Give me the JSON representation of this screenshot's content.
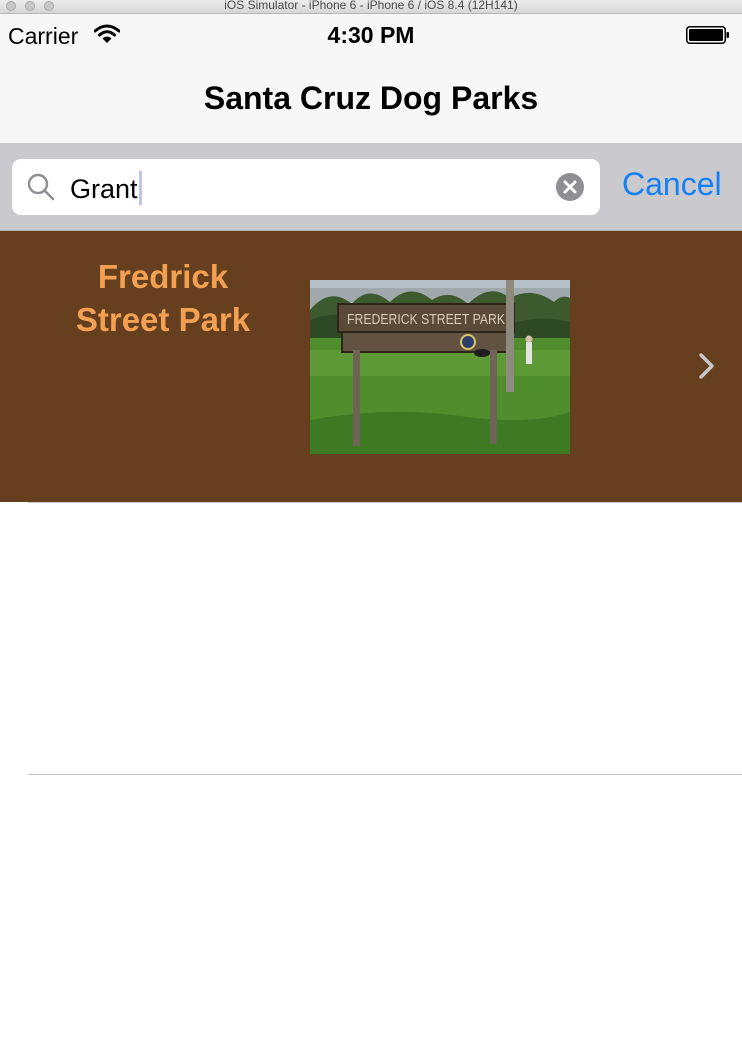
{
  "simulator": {
    "window_title": "iOS Simulator - iPhone 6 - iPhone 6 / iOS 8.4 (12H141)"
  },
  "status_bar": {
    "carrier": "Carrier",
    "time": "4:30 PM",
    "wifi_icon": "wifi-icon",
    "battery_icon": "battery-icon"
  },
  "nav": {
    "title": "Santa Cruz Dog Parks"
  },
  "search": {
    "value": "Grant",
    "cancel_label": "Cancel",
    "search_icon": "magnifier-icon",
    "clear_icon": "clear-x-icon"
  },
  "results": [
    {
      "name": "Fredrick Street Park",
      "photo_sign_text": "FREDERICK STREET PARK",
      "accessory_icon": "chevron-right-icon"
    }
  ],
  "colors": {
    "row_background": "#653f1e",
    "park_name_text": "#f4a052",
    "tint": "#1480f8",
    "search_bar_background": "#c9c9ce"
  }
}
